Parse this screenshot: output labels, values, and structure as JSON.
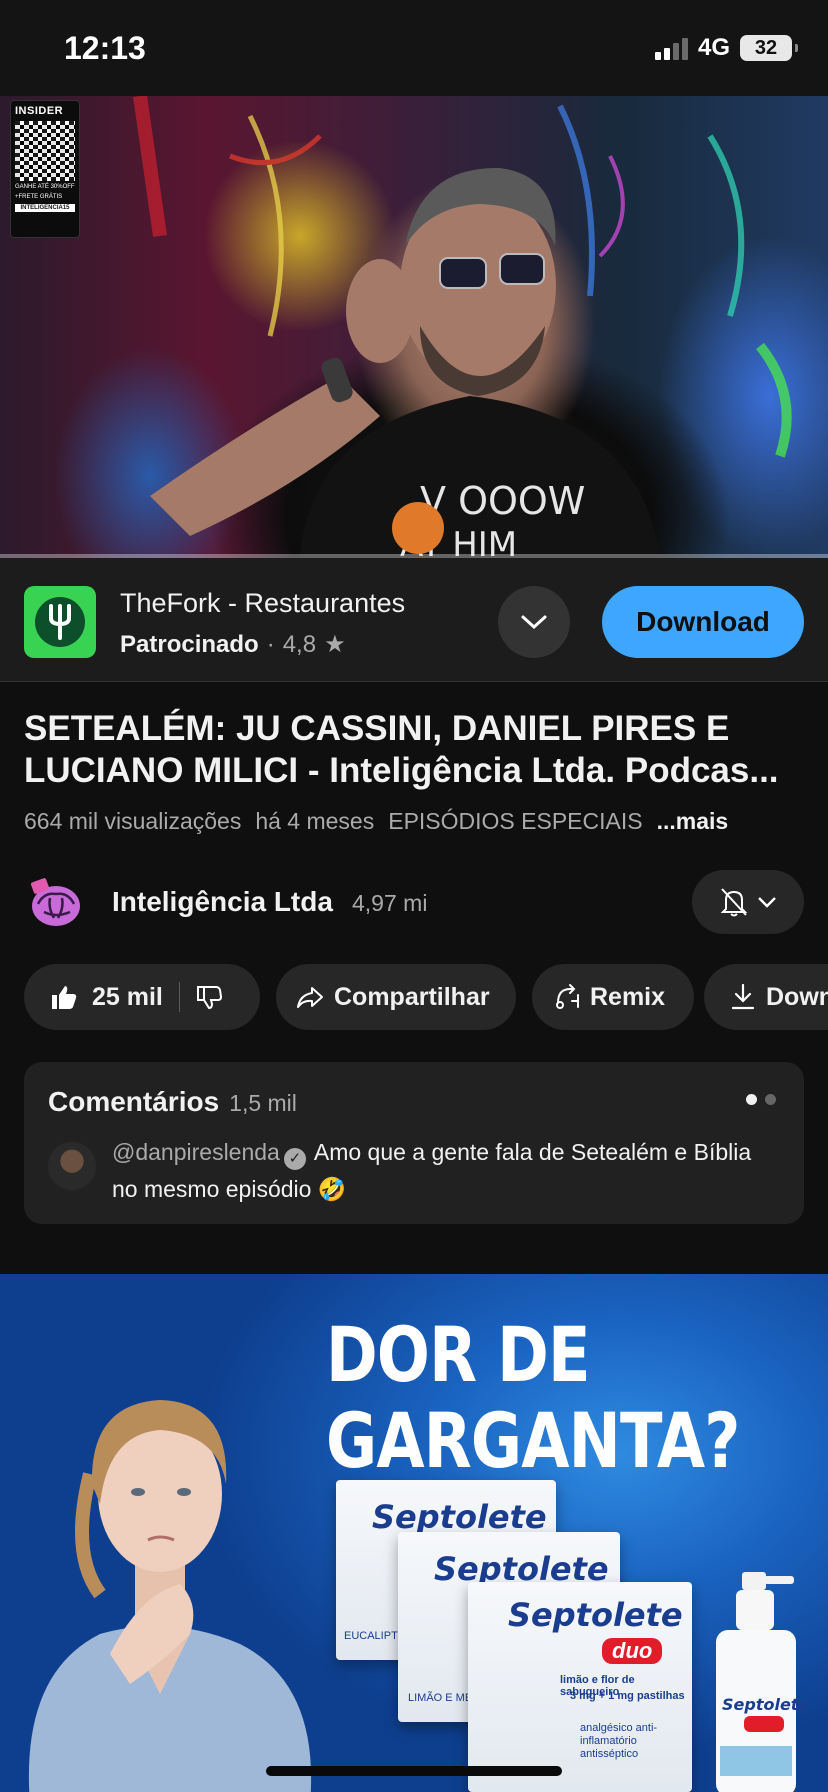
{
  "status_bar": {
    "time": "12:13",
    "network": "4G",
    "battery": "32"
  },
  "video": {
    "overlay_ad": {
      "brand": "INSIDER",
      "line1": "GANHE ATÉ 30%OFF",
      "line2": "+FRETE GRÁTIS",
      "tag": "INTELIGENCIA15"
    },
    "progress": 0.0
  },
  "sponsored": {
    "title": "TheFork - Restaurantes",
    "label": "Patrocinado",
    "separator": "·",
    "rating": "4,8",
    "rating_icon": "★",
    "download_label": "Download",
    "accent_color": "#3ea6ff",
    "logo_color": "#39d353"
  },
  "video_info": {
    "title": "SETEALÉM: JU CASSINI, DANIEL PIRES E LUCIANO MILICI - Inteligência Ltda. Podcas...",
    "views": "664 mil visualizações",
    "age": "há 4 meses",
    "category": "EPISÓDIOS ESPECIAIS",
    "more": "...mais"
  },
  "channel": {
    "name": "Inteligência Ltda",
    "subscribers": "4,97 mi"
  },
  "actions": {
    "likes": "25 mil",
    "share": "Compartilhar",
    "remix": "Remix",
    "download": "Down"
  },
  "comments": {
    "title": "Comentários",
    "count": "1,5 mil",
    "top_comment": {
      "user": "@danpireslenda",
      "text": "Amo que a gente fala de Setealém e Bíblia no mesmo episódio 🤣"
    }
  },
  "banner_ad": {
    "headline_line1": "DOR DE",
    "headline_line2": "GARGANTA?",
    "product": "Septolete",
    "product_variant": "duo",
    "box_note_1": "EUCALIPTO",
    "box_note_2": "LIMÃO E MEL",
    "box_desc": "limão e flor de sabugueiro",
    "box_dose": "3 mg + 1 mg pastilhas",
    "box_type": "analgésico anti-inflamatório antisséptico",
    "background_color": "#1a63c0"
  }
}
